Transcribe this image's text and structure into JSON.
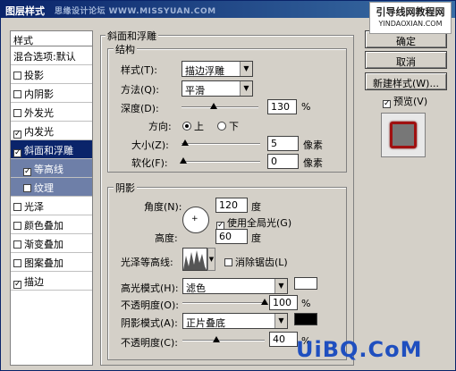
{
  "window": {
    "title": "图层样式",
    "watermark": "思缘设计论坛 WWW.MISSYUAN.COM"
  },
  "site": {
    "line1": "引导线网教程网",
    "line2": "YINDAOXIAN.COM"
  },
  "left": {
    "header": "样式",
    "items": [
      {
        "label": "混合选项:默认",
        "checked": ""
      },
      {
        "label": "投影",
        "checked": ""
      },
      {
        "label": "内阴影",
        "checked": ""
      },
      {
        "label": "外发光",
        "checked": ""
      },
      {
        "label": "内发光",
        "checked": "✓"
      },
      {
        "label": "斜面和浮雕",
        "checked": "✓"
      },
      {
        "label": "等高线",
        "checked": "✓"
      },
      {
        "label": "纹理",
        "checked": ""
      },
      {
        "label": "光泽",
        "checked": ""
      },
      {
        "label": "颜色叠加",
        "checked": ""
      },
      {
        "label": "渐变叠加",
        "checked": ""
      },
      {
        "label": "图案叠加",
        "checked": ""
      },
      {
        "label": "描边",
        "checked": "✓"
      }
    ]
  },
  "bevel": {
    "title": "斜面和浮雕",
    "structure": {
      "title": "结构",
      "style_label": "样式(T):",
      "style_value": "描边浮雕",
      "method_label": "方法(Q):",
      "method_value": "平滑",
      "depth_label": "深度(D):",
      "depth_value": "130",
      "depth_unit": "%",
      "direction_label": "方向:",
      "dir_up": "上",
      "dir_down": "下",
      "size_label": "大小(Z):",
      "size_value": "5",
      "size_unit": "像素",
      "soften_label": "软化(F):",
      "soften_value": "0",
      "soften_unit": "像素"
    },
    "shading": {
      "title": "阴影",
      "angle_label": "角度(N):",
      "angle_value": "120",
      "angle_unit": "度",
      "global_light": "使用全局光(G)",
      "altitude_label": "高度:",
      "altitude_value": "60",
      "altitude_unit": "度",
      "gloss_label": "光泽等高线:",
      "antialias": "消除锯齿(L)",
      "highlight_label": "高光模式(H):",
      "highlight_value": "滤色",
      "highlight_opacity_label": "不透明度(O):",
      "highlight_opacity": "100",
      "shadow_label": "阴影模式(A):",
      "shadow_value": "正片叠底",
      "shadow_opacity_label": "不透明度(C):",
      "shadow_opacity": "40",
      "pct": "%"
    }
  },
  "buttons": {
    "ok": "确定",
    "cancel": "取消",
    "new_style": "新建样式(W)...",
    "preview": "预览(V)"
  },
  "colors": {
    "highlight": "#ffffff",
    "shadow": "#000000",
    "preview_ring": "#a01010"
  },
  "branding": "UiBQ.CoM"
}
